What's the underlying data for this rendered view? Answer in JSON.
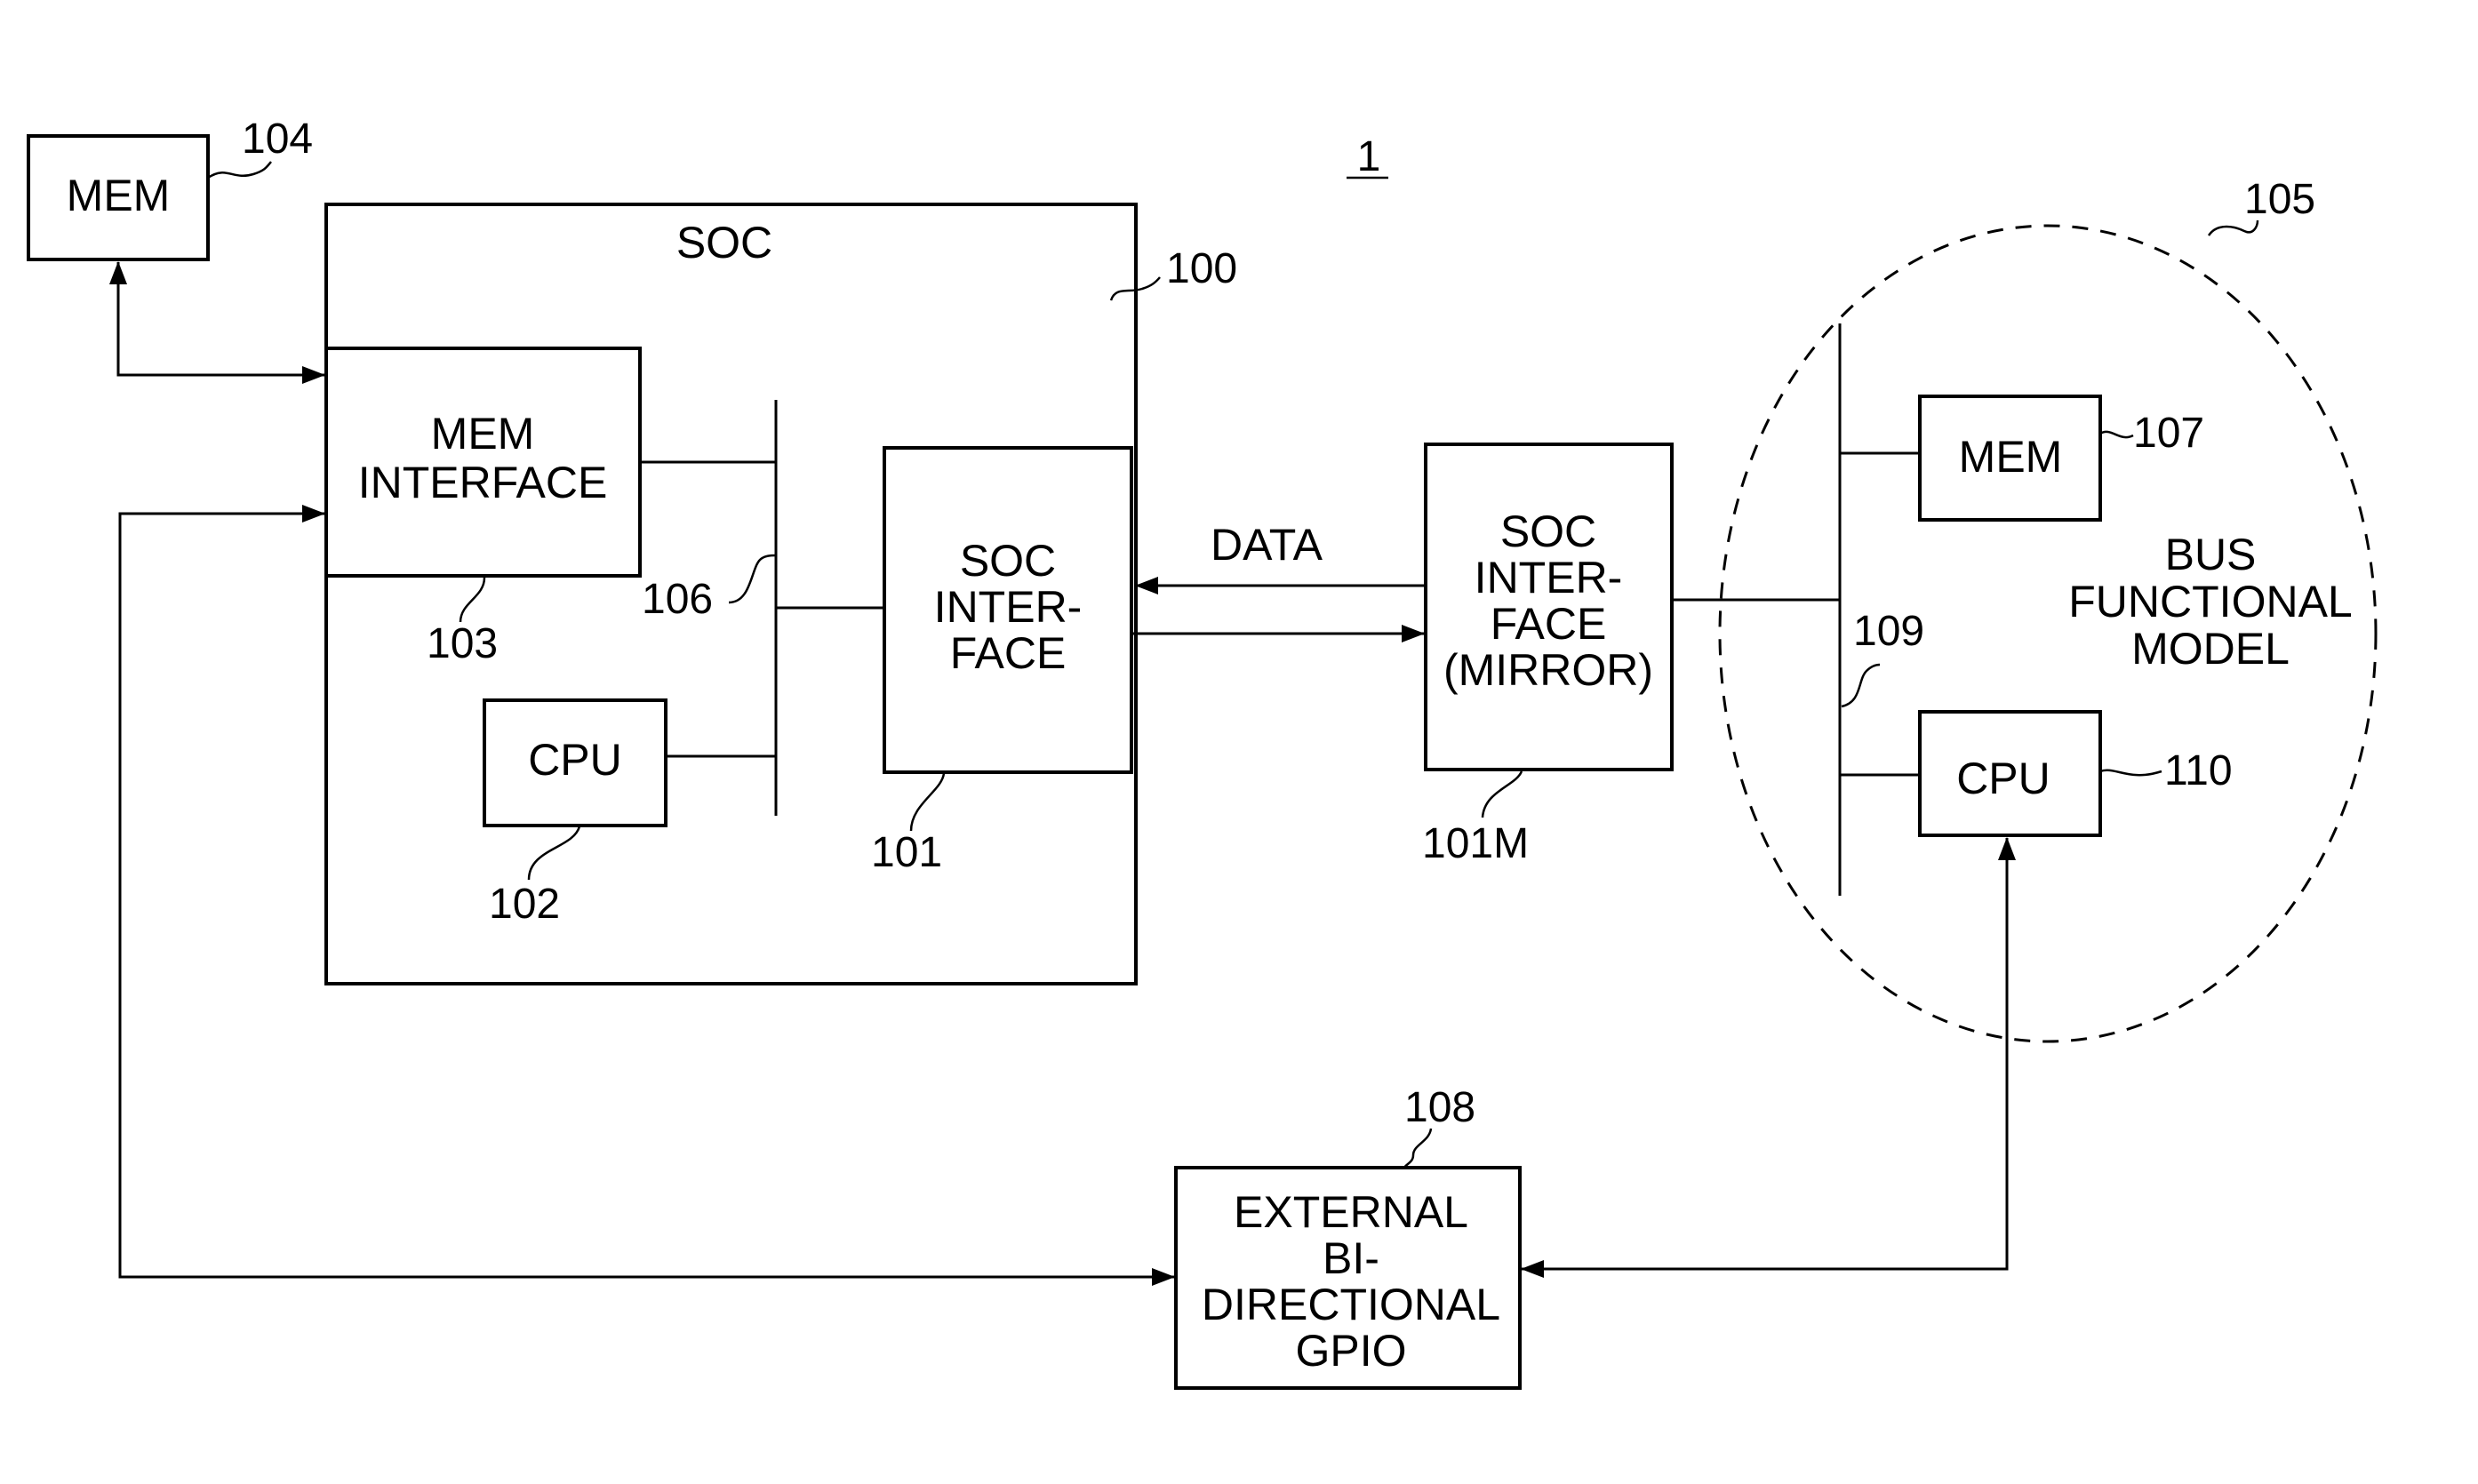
{
  "figure": {
    "number": "1",
    "blocks": {
      "mem_external": {
        "ref": "104",
        "lines": [
          "MEM"
        ]
      },
      "soc": {
        "ref": "100",
        "lines": [
          "SOC"
        ]
      },
      "mem_interface": {
        "ref": "103",
        "lines": [
          "MEM",
          "INTERFACE"
        ]
      },
      "cpu_soc": {
        "ref": "102",
        "lines": [
          "CPU"
        ]
      },
      "soc_bus": {
        "ref": "106"
      },
      "soc_interface": {
        "ref": "101",
        "lines": [
          "SOC",
          "INTER-",
          "FACE"
        ]
      },
      "soc_interface_mirror": {
        "ref": "101M",
        "lines": [
          "SOC",
          "INTER-",
          "FACE",
          "(MIRROR)"
        ]
      },
      "bus_functional_model": {
        "ref": "105",
        "lines": [
          "BUS",
          "FUNCTIONAL",
          "MODEL"
        ]
      },
      "bfm_bus": {
        "ref": "109"
      },
      "mem_bfm": {
        "ref": "107",
        "lines": [
          "MEM"
        ]
      },
      "cpu_bfm": {
        "ref": "110",
        "lines": [
          "CPU"
        ]
      },
      "gpio": {
        "ref": "108",
        "lines": [
          "EXTERNAL",
          "BI-",
          "DIRECTIONAL",
          "GPIO"
        ]
      }
    },
    "connections": {
      "data_label": "DATA"
    }
  }
}
